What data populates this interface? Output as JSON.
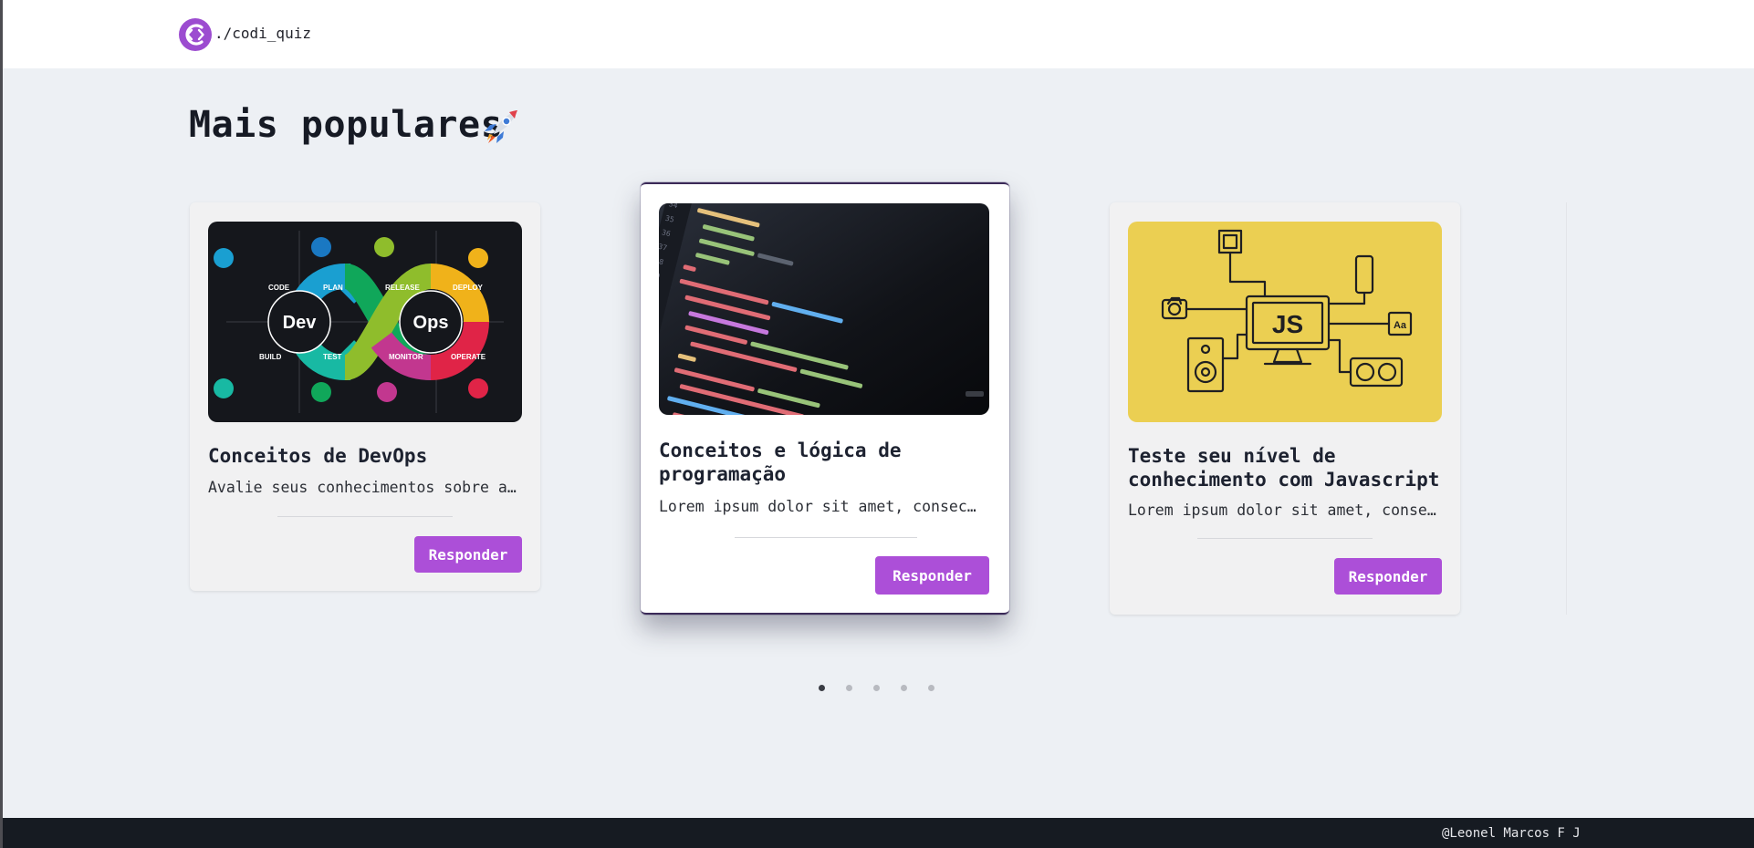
{
  "header": {
    "logo_text": "./codi_quiz",
    "logo_icon": "codi-quiz-logo-icon",
    "brand_color": "#9c4cd0"
  },
  "main": {
    "title": "Mais populares",
    "title_emoji": "rocket-icon"
  },
  "cards": [
    {
      "title": "Conceitos de DevOps",
      "description": "Avalie seus conhecimentos sobre a …",
      "button_label": "Responder",
      "image": "devops-infinity-image",
      "image_labels": [
        "Dev",
        "Ops",
        "CODE",
        "PLAN",
        "RELEASE",
        "DEPLOY",
        "BUILD",
        "TEST",
        "MONITOR",
        "OPERATE"
      ]
    },
    {
      "title": "Conceitos e lógica de programação",
      "description": "Lorem ipsum dolor sit amet, consec…",
      "button_label": "Responder",
      "image": "code-editor-image"
    },
    {
      "title": "Teste seu nível de conhecimento com Javascript",
      "description": "Lorem ipsum dolor sit amet, consec…",
      "button_label": "Responder",
      "image": "javascript-devices-image",
      "image_labels": [
        "JS",
        "Aa"
      ]
    }
  ],
  "carousel": {
    "page_count": 5,
    "active_index": 0
  },
  "footer": {
    "text": "@Leonel Marcos F J"
  },
  "colors": {
    "accent": "#ac4fd8",
    "background": "#edf0f4",
    "footer": "#161b22"
  }
}
